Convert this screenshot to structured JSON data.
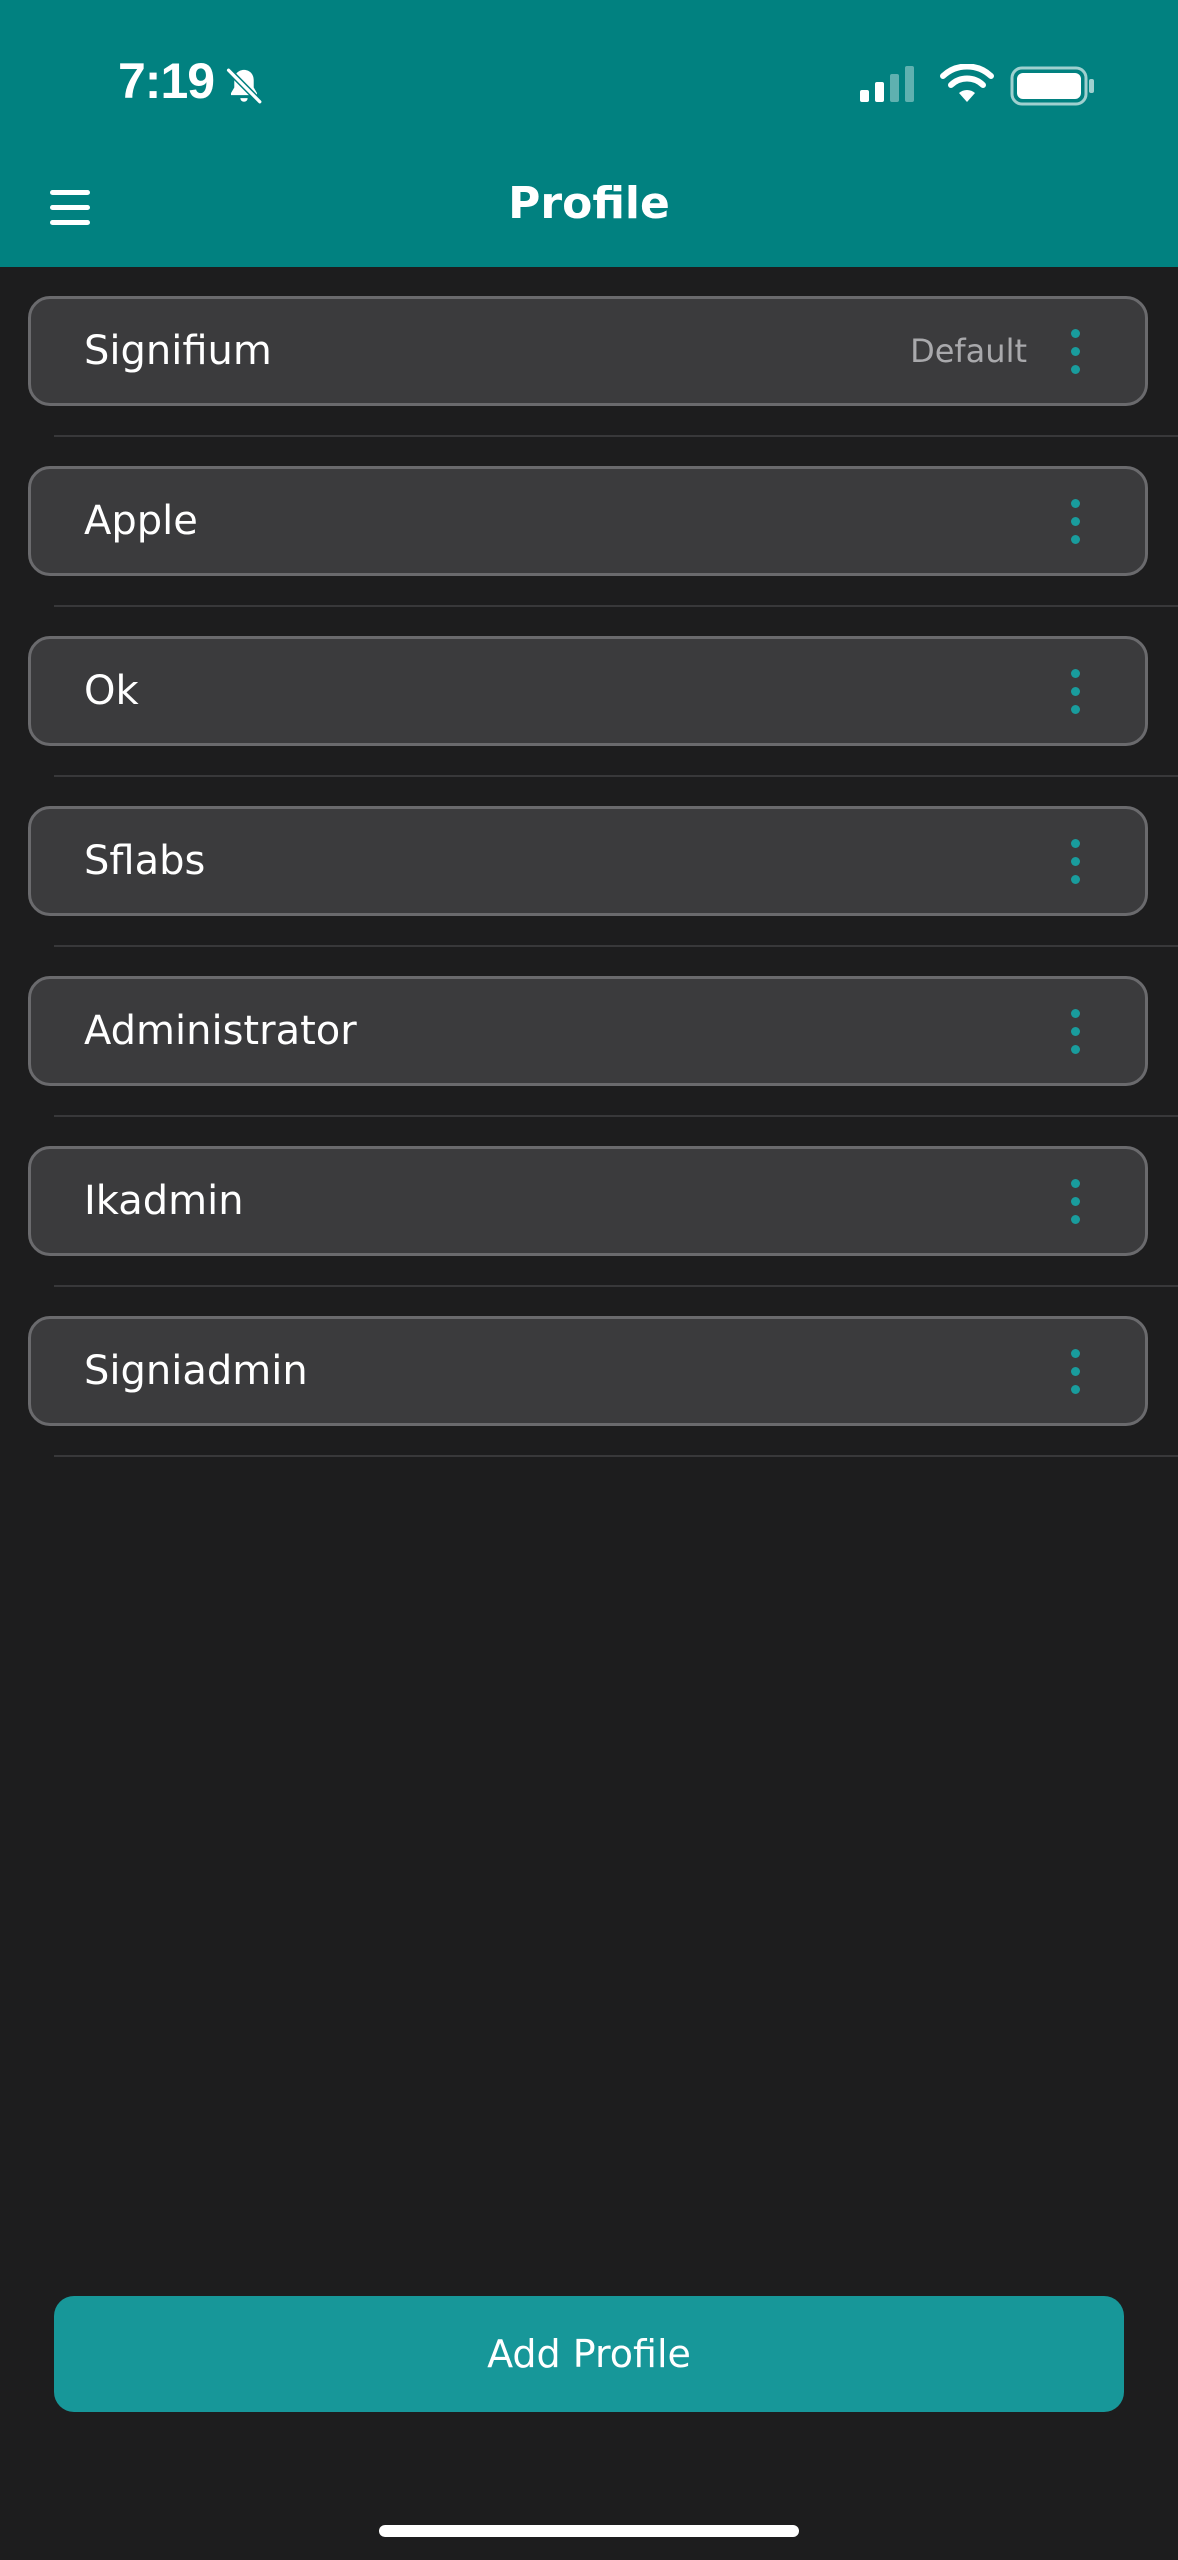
{
  "status_bar": {
    "time": "7:19",
    "icons": [
      "bell-slash-icon",
      "cellular-signal-icon",
      "wifi-icon",
      "battery-icon"
    ]
  },
  "header": {
    "title": "Profile",
    "menu_icon": "hamburger-menu-icon"
  },
  "profiles": [
    {
      "name": "Signifium",
      "badge": "Default"
    },
    {
      "name": "Apple",
      "badge": ""
    },
    {
      "name": "Ok",
      "badge": ""
    },
    {
      "name": "Sflabs",
      "badge": ""
    },
    {
      "name": "Administrator",
      "badge": ""
    },
    {
      "name": "Ikadmin",
      "badge": ""
    },
    {
      "name": "Signiadmin",
      "badge": ""
    }
  ],
  "row_action_icon": "more-vertical-icon",
  "footer": {
    "add_label": "Add Profile"
  },
  "colors": {
    "header_bg": "#018180",
    "page_bg": "#1d1d1e",
    "card_bg": "#3b3b3d",
    "card_border": "#6a6a6d",
    "accent": "#179799",
    "muted_text": "#a9a9ac"
  }
}
